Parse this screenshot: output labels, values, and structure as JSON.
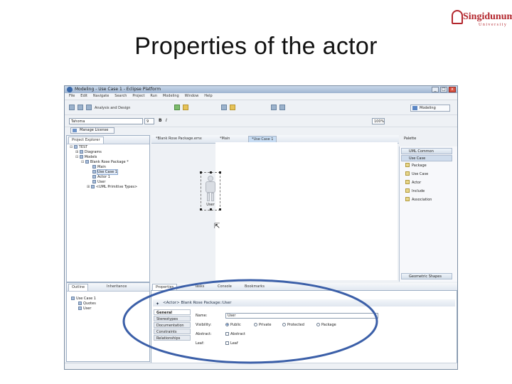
{
  "slide": {
    "title": "Properties of the actor"
  },
  "logo": {
    "main": "Singidunum",
    "sub": "University"
  },
  "window": {
    "title": "Modeling - Use Case 1 - Eclipse Platform",
    "controls": {
      "minimize": "_",
      "maximize": "□",
      "close": "x"
    }
  },
  "menu": [
    "File",
    "Edit",
    "Navigate",
    "Search",
    "Project",
    "Run",
    "Modeling",
    "Window",
    "Help"
  ],
  "toolbar": {
    "perspective_label": "Analysis and Design",
    "font_value": "Tahoma",
    "font_size": "9",
    "bold": "B",
    "italic": "I",
    "zoom": "100%",
    "perspective_button": "Modeling",
    "manager_button": "Manage License"
  },
  "project_explorer": {
    "tab": "Project Explorer",
    "tree": [
      {
        "label": "TEST",
        "indent": 0,
        "expander": "⊟"
      },
      {
        "label": "Diagrams",
        "indent": 1,
        "expander": "⊞"
      },
      {
        "label": "Models",
        "indent": 1,
        "expander": "⊟"
      },
      {
        "label": "Blank Rose Package *",
        "indent": 2,
        "expander": "⊟"
      },
      {
        "label": "Main",
        "indent": 3,
        "expander": ""
      },
      {
        "label": "Use Case 1",
        "indent": 3,
        "expander": ""
      },
      {
        "label": "Actor 1",
        "indent": 3,
        "expander": ""
      },
      {
        "label": "User",
        "indent": 3,
        "expander": ""
      },
      {
        "label": "<UML Primitive Types>",
        "indent": 3,
        "expander": "⊞"
      }
    ]
  },
  "editor_tabs": [
    "*Blank Rose Package.emx",
    "*Main",
    "*Use Case 1"
  ],
  "diagram": {
    "actor_name": "User"
  },
  "palette": {
    "title": "Palette",
    "drawers": [
      "UML Common",
      "Use Case"
    ],
    "items": [
      "Package",
      "Use Case",
      "Actor",
      "Include",
      "Association"
    ],
    "footer": "Geometric Shapes"
  },
  "outline": {
    "tabs": [
      "Outline",
      "Inheritance"
    ],
    "tree": [
      {
        "label": "Use Case 1",
        "indent": 0
      },
      {
        "label": "Quotes",
        "indent": 1
      },
      {
        "label": "User",
        "indent": 1
      }
    ]
  },
  "bottom_tabs": [
    "Properties",
    "Tasks",
    "Console",
    "Bookmarks"
  ],
  "properties": {
    "header": "<Actor> Blank Rose Package::User",
    "side_tabs": [
      "General",
      "Stereotypes",
      "Documentation",
      "Constraints",
      "Relationships"
    ],
    "labels": {
      "name": "Name:",
      "visibility": "Visibility:",
      "abstract": "Abstract:",
      "leaf": "Leaf:"
    },
    "name_value": "User",
    "visibility_options": [
      "Public",
      "Private",
      "Protected",
      "Package"
    ],
    "selected_visibility": "Public",
    "abstract_option": "Abstract",
    "leaf_option": "Leaf"
  },
  "annotation": {
    "color": "#3b5fa8"
  }
}
